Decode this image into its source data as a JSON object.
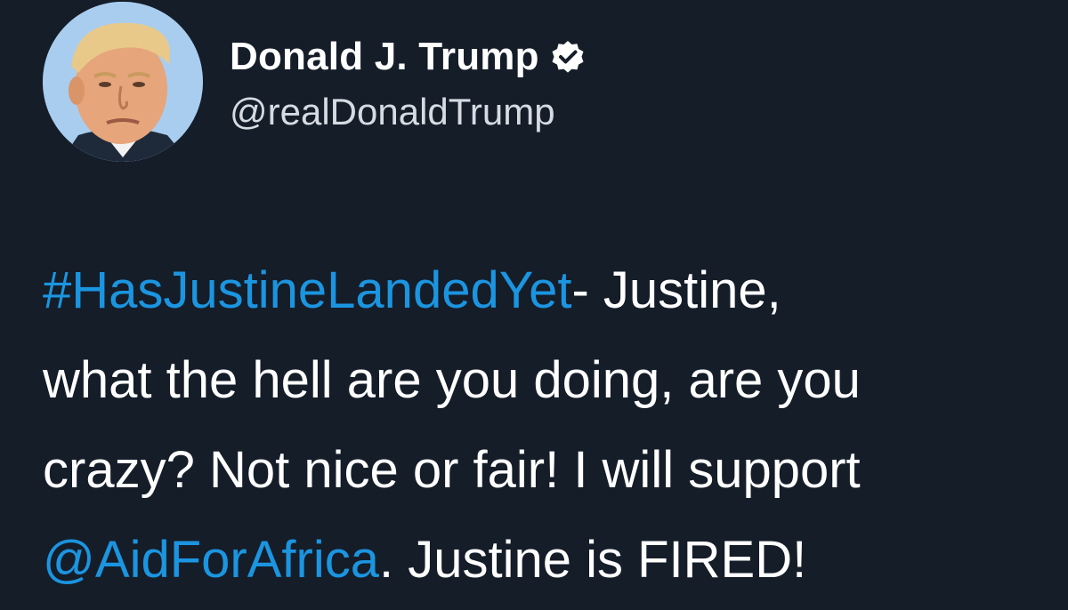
{
  "author": {
    "display_name": "Donald J. Trump",
    "handle": "@realDonaldTrump",
    "verified_icon": "verified-badge-icon",
    "avatar": "profile-photo"
  },
  "tweet": {
    "hashtag": "#HasJustineLandedYet",
    "line1_rest": "- Justine,",
    "line2": "what the hell are you doing, are you",
    "line3": "crazy? Not nice or fair! I will support",
    "mention": "@AidForAfrica",
    "line4_rest": ". Justine is FIRED!"
  },
  "colors": {
    "background": "#151d29",
    "link": "#1b95e0",
    "text": "#ffffff",
    "handle": "#d5dbe1"
  }
}
